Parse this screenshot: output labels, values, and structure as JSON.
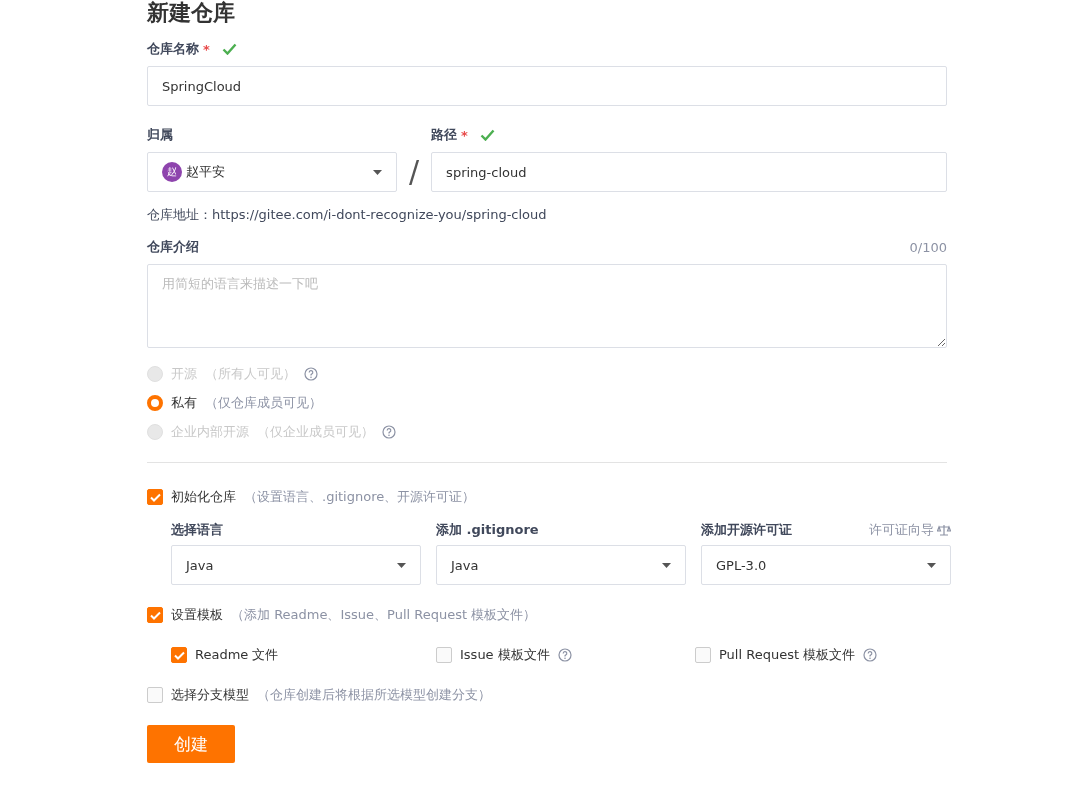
{
  "title": "新建仓库",
  "name_field": {
    "label": "仓库名称",
    "required": "*",
    "valid": true,
    "value": "SpringCloud"
  },
  "owner": {
    "label": "归属",
    "avatar": "赵",
    "value": "赵平安"
  },
  "separator": "/",
  "path_field": {
    "label": "路径",
    "required": "*",
    "valid": true,
    "value": "spring-cloud"
  },
  "address": "仓库地址：https://gitee.com/i-dont-recognize-you/spring-cloud",
  "description": {
    "label": "仓库介绍",
    "counter": "0/100",
    "placeholder": "用简短的语言来描述一下吧"
  },
  "visibility": [
    {
      "label": "开源",
      "note": "（所有人可见）",
      "selected": false,
      "disabled": true,
      "help": true
    },
    {
      "label": "私有",
      "note": "（仅仓库成员可见）",
      "selected": true,
      "disabled": false,
      "help": false
    },
    {
      "label": "企业内部开源",
      "note": "（仅企业成员可见）",
      "selected": false,
      "disabled": true,
      "help": true
    }
  ],
  "init": {
    "label": "初始化仓库",
    "note": "（设置语言、.gitignore、开源许可证）",
    "checked": true
  },
  "selects": [
    {
      "label": "选择语言",
      "value": "Java"
    },
    {
      "label": "添加 .gitignore",
      "value": "Java"
    },
    {
      "label": "添加开源许可证",
      "value": "GPL-3.0",
      "extra": "许可证向导"
    }
  ],
  "template": {
    "label": "设置模板",
    "note": "（添加 Readme、Issue、Pull Request 模板文件）",
    "checked": true
  },
  "template_files": [
    {
      "label": "Readme 文件",
      "checked": true,
      "help": false
    },
    {
      "label": "Issue 模板文件",
      "checked": false,
      "help": true
    },
    {
      "label": "Pull Request 模板文件",
      "checked": false,
      "help": true
    }
  ],
  "branch": {
    "label": "选择分支模型",
    "note": "（仓库创建后将根据所选模型创建分支）",
    "checked": false
  },
  "submit": "创建"
}
